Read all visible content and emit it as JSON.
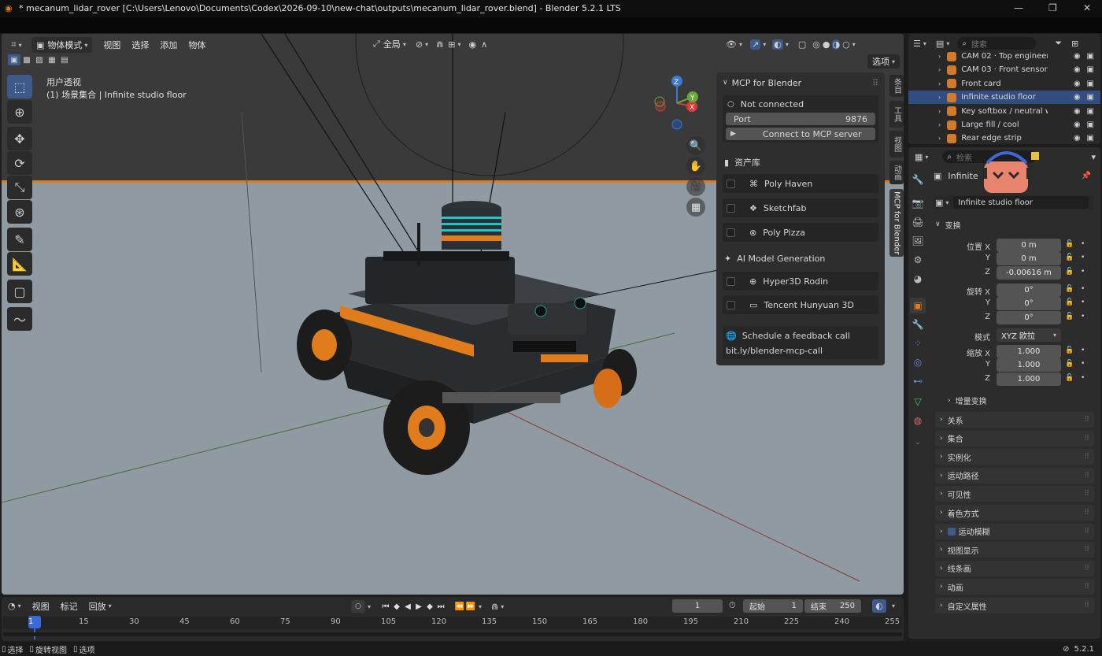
{
  "title_bar": {
    "title": "* mecanum_lidar_rover [C:\\Users\\Lenovo\\Documents\\Codex\\2026-09-10\\new-chat\\outputs\\mecanum_lidar_rover.blend] - Blender 5.2.1 LTS"
  },
  "viewport": {
    "mode": "物体模式",
    "menus": [
      "视图",
      "选择",
      "添加",
      "物体"
    ],
    "transform_orientation": "全局",
    "options_label": "选项",
    "info_line1": "用户透视",
    "info_line2": "(1) 场景集合 | Infinite studio floor",
    "gizmo": {
      "x": "X",
      "y": "Y",
      "z": "Z"
    }
  },
  "mcp_panel": {
    "title": "MCP for Blender",
    "status": "Not connected",
    "port_label": "Port",
    "port_value": "9876",
    "connect_label": "Connect to MCP server",
    "asset_section": "资产库",
    "assets": [
      "Poly Haven",
      "Sketchfab",
      "Poly Pizza"
    ],
    "ai_section": "AI Model Generation",
    "ai_items": [
      "Hyper3D Rodin",
      "Tencent Hunyuan 3D"
    ],
    "feedback_title": "Schedule a feedback call",
    "feedback_link": "bit.ly/blender-mcp-call"
  },
  "side_tabs": [
    "条目",
    "工具",
    "视图",
    "动画",
    "MCP for Blender"
  ],
  "outliner": {
    "search_placeholder": "搜索",
    "items": [
      {
        "name": "CAM 02 · Top engineerin",
        "selected": false
      },
      {
        "name": "CAM 03 · Front sensor vi",
        "selected": false
      },
      {
        "name": "Front card",
        "selected": false
      },
      {
        "name": "Infinite studio floor",
        "selected": true
      },
      {
        "name": "Key softbox / neutral war",
        "selected": false
      },
      {
        "name": "Large fill / cool",
        "selected": false
      },
      {
        "name": "Rear edge strip",
        "selected": false
      }
    ]
  },
  "properties": {
    "search_placeholder": "检索",
    "object_name_header": "Infinite s",
    "object_name": "Infinite studio floor",
    "transform_section": "变换",
    "location_label": "位置",
    "rotation_label": "旋转",
    "scale_label": "缩放",
    "axis": [
      "X",
      "Y",
      "Z"
    ],
    "location": [
      "0 m",
      "0 m",
      "-0.00616 m"
    ],
    "rotation": [
      "0°",
      "0°",
      "0°"
    ],
    "mode_label": "模式",
    "mode_value": "XYZ 欧拉",
    "scale": [
      "1.000",
      "1.000",
      "1.000"
    ],
    "delta_transform": "增量变换",
    "sections": [
      "关系",
      "集合",
      "实例化",
      "运动路径",
      "可见性",
      "着色方式",
      "运动模糊",
      "视图显示",
      "线条画",
      "动画",
      "自定义属性"
    ]
  },
  "timeline": {
    "menus": [
      "视图",
      "标记",
      "回放"
    ],
    "current_frame": "1",
    "start_label": "起始",
    "start_value": "1",
    "end_label": "结束",
    "end_value": "250",
    "ruler": [
      "1",
      "15",
      "30",
      "45",
      "60",
      "75",
      "90",
      "105",
      "120",
      "135",
      "150",
      "165",
      "180",
      "195",
      "210",
      "225",
      "240",
      "255"
    ]
  },
  "status_bar": {
    "items": [
      "选择",
      "旋转视图",
      "选项"
    ],
    "version": "5.2.1"
  },
  "colors": {
    "accent_blue": "#334d80",
    "orange": "#e07c1c",
    "panel": "#2e2e2e"
  }
}
